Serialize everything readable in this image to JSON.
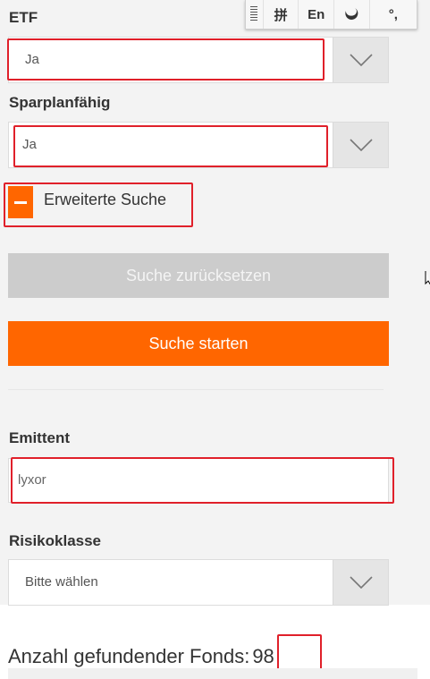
{
  "filters": {
    "etf": {
      "label": "ETF",
      "value": "Ja"
    },
    "sparplan": {
      "label": "Sparplanfähig",
      "value": "Ja"
    },
    "advanced_toggle": {
      "label": "Erweiterte Suche",
      "icon": "minus-icon"
    },
    "reset_button": "Suche zurücksetzen",
    "start_button": "Suche starten",
    "emittent": {
      "label": "Emittent",
      "value": "lyxor"
    },
    "risikoklasse": {
      "label": "Risikoklasse",
      "value": "Bitte wählen"
    }
  },
  "results": {
    "count_label": "Anzahl gefundender Fonds:",
    "count": "98"
  },
  "ime_toolbar": {
    "items": [
      "grip-icon",
      "拼",
      "En",
      "moon-icon",
      "°,"
    ]
  },
  "colors": {
    "accent": "#ff6600",
    "highlight": "#e0202a",
    "panel": "#f3f3f3",
    "reset": "#cccccc"
  }
}
